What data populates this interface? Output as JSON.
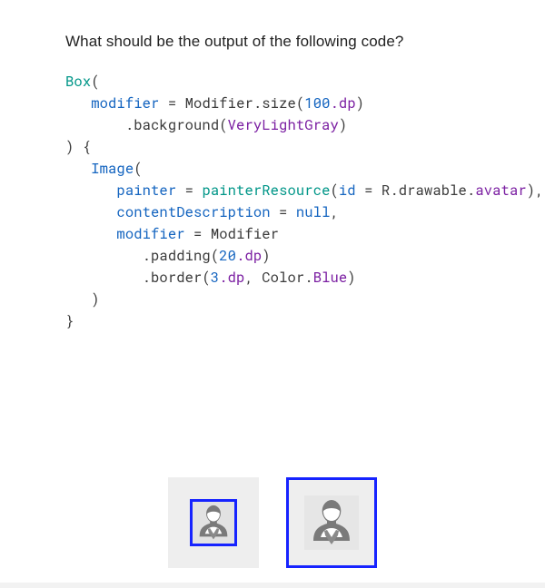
{
  "question": "What should be the output of the following code?",
  "code": {
    "l1_box": "Box",
    "l2_modifier": "modifier",
    "l2_eq": " = ",
    "l2_Modifier": "Modifier",
    "l2_size": ".size(",
    "l2_100": "100",
    "l2_dp": ".dp",
    "l3_bg": ".background(",
    "l3_col": "VeryLightGray",
    "l5_image": "Image",
    "l6_painter": "painter",
    "l6_eq": " = ",
    "l6_presource": "painterResource",
    "l6_id": "id",
    "l6_eq2": " = ",
    "l6_r": "R.drawable.",
    "l6_avatar": "avatar",
    "l7_cd": "contentDescription",
    "l7_eq": " = ",
    "l7_null": "null",
    "l8_modifier": "modifier",
    "l8_eq": " = ",
    "l8_Modifier": "Modifier",
    "l9_pad": ".padding(",
    "l9_20": "20",
    "l9_dp": ".dp",
    "l10_bor": ".border(",
    "l10_3": "3",
    "l10_dp": ".dp",
    "l10_colorpre": ", Color.",
    "l10_blue": "Blue"
  },
  "options": {
    "a": {
      "name": "option-a"
    },
    "b": {
      "name": "option-b"
    }
  },
  "colors": {
    "blue_border": "#1623ff",
    "very_light_gray": "#eeeeee"
  }
}
